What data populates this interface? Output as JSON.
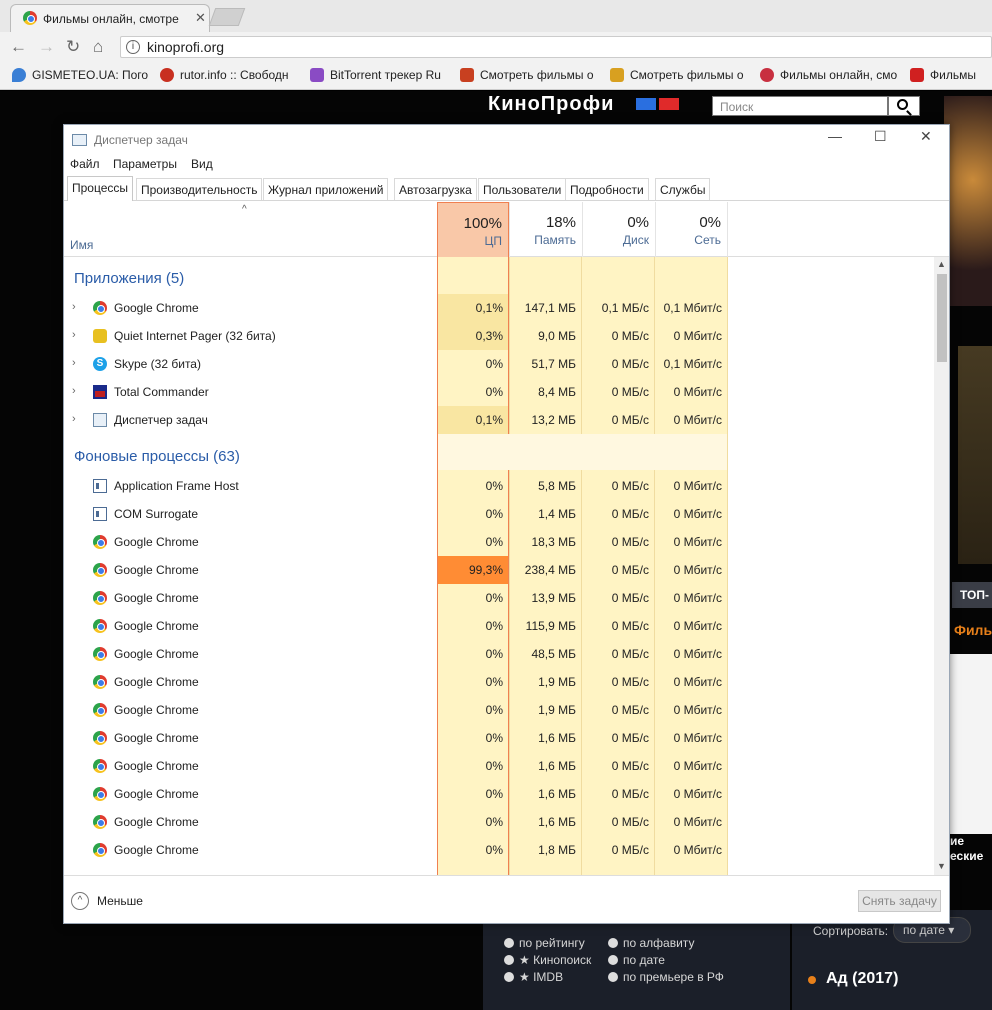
{
  "browser": {
    "tab_title": "Фильмы онлайн, смотре",
    "url": "kinoprofi.org",
    "bookmarks": [
      {
        "label": "GISMETEO.UA: Погод",
        "color": "#3a7fd5"
      },
      {
        "label": "rutor.info :: Свободн",
        "color": "#c83020"
      },
      {
        "label": "BitTorrent трекер Ru",
        "color": "#8a4bc4"
      },
      {
        "label": "Смотреть фильмы о",
        "color": "#c84020"
      },
      {
        "label": "Смотреть фильмы о",
        "color": "#d8a020"
      },
      {
        "label": "Фильмы онлайн, смо",
        "color": "#c83040"
      },
      {
        "label": "Фильмы",
        "color": "#d02020"
      }
    ]
  },
  "site": {
    "logo": "КиноПрофи",
    "search_placeholder": "Поиск",
    "top_button": "ТОП-",
    "films_label": "Филь",
    "side_text": [
      "ие",
      "еские"
    ],
    "sort": {
      "options_left": [
        "по рейтингу",
        "★ Кинопоиск",
        "★ IMDB"
      ],
      "options_right": [
        "по алфавиту",
        "по дате",
        "по премьере в РФ"
      ],
      "sort_label": "Сортировать:",
      "sort_value": "по дате"
    },
    "movie_title": "Ад (2017)"
  },
  "taskmanager": {
    "window_title": "Диспетчер задач",
    "menu": [
      "Файл",
      "Параметры",
      "Вид"
    ],
    "tabs": [
      "Процессы",
      "Производительность",
      "Журнал приложений",
      "Автозагрузка",
      "Пользователи",
      "Подробности",
      "Службы"
    ],
    "columns": {
      "name": "Имя",
      "cpu": {
        "pct": "100%",
        "label": "ЦП"
      },
      "mem": {
        "pct": "18%",
        "label": "Память"
      },
      "disk": {
        "pct": "0%",
        "label": "Диск"
      },
      "net": {
        "pct": "0%",
        "label": "Сеть"
      }
    },
    "group_apps": "Приложения (5)",
    "apps": [
      {
        "name": "Google Chrome",
        "icon": "chrome-icon",
        "cpu": "0,1%",
        "mem": "147,1 МБ",
        "disk": "0,1 МБ/с",
        "net": "0,1 Мбит/с"
      },
      {
        "name": "Quiet Internet Pager (32 бита)",
        "icon": "qip-icon",
        "cpu": "0,3%",
        "mem": "9,0 МБ",
        "disk": "0 МБ/с",
        "net": "0 Мбит/с"
      },
      {
        "name": "Skype (32 бита)",
        "icon": "skype-icon",
        "cpu": "0%",
        "mem": "51,7 МБ",
        "disk": "0 МБ/с",
        "net": "0,1 Мбит/с"
      },
      {
        "name": "Total Commander",
        "icon": "total-commander-icon",
        "cpu": "0%",
        "mem": "8,4 МБ",
        "disk": "0 МБ/с",
        "net": "0 Мбит/с"
      },
      {
        "name": "Диспетчер задач",
        "icon": "task-manager-icon",
        "cpu": "0,1%",
        "mem": "13,2 МБ",
        "disk": "0 МБ/с",
        "net": "0 Мбит/с"
      }
    ],
    "group_bg": "Фоновые процессы (63)",
    "bg": [
      {
        "name": "Application Frame Host",
        "icon": "app-frame-icon",
        "cpu": "0%",
        "mem": "5,8 МБ",
        "disk": "0 МБ/с",
        "net": "0 Мбит/с"
      },
      {
        "name": "COM Surrogate",
        "icon": "app-frame-icon",
        "cpu": "0%",
        "mem": "1,4 МБ",
        "disk": "0 МБ/с",
        "net": "0 Мбит/с"
      },
      {
        "name": "Google Chrome",
        "icon": "chrome-icon",
        "cpu": "0%",
        "mem": "18,3 МБ",
        "disk": "0 МБ/с",
        "net": "0 Мбит/с"
      },
      {
        "name": "Google Chrome",
        "icon": "chrome-icon",
        "cpu": "99,3%",
        "mem": "238,4 МБ",
        "disk": "0 МБ/с",
        "net": "0 Мбит/с"
      },
      {
        "name": "Google Chrome",
        "icon": "chrome-icon",
        "cpu": "0%",
        "mem": "13,9 МБ",
        "disk": "0 МБ/с",
        "net": "0 Мбит/с"
      },
      {
        "name": "Google Chrome",
        "icon": "chrome-icon",
        "cpu": "0%",
        "mem": "115,9 МБ",
        "disk": "0 МБ/с",
        "net": "0 Мбит/с"
      },
      {
        "name": "Google Chrome",
        "icon": "chrome-icon",
        "cpu": "0%",
        "mem": "48,5 МБ",
        "disk": "0 МБ/с",
        "net": "0 Мбит/с"
      },
      {
        "name": "Google Chrome",
        "icon": "chrome-icon",
        "cpu": "0%",
        "mem": "1,9 МБ",
        "disk": "0 МБ/с",
        "net": "0 Мбит/с"
      },
      {
        "name": "Google Chrome",
        "icon": "chrome-icon",
        "cpu": "0%",
        "mem": "1,9 МБ",
        "disk": "0 МБ/с",
        "net": "0 Мбит/с"
      },
      {
        "name": "Google Chrome",
        "icon": "chrome-icon",
        "cpu": "0%",
        "mem": "1,6 МБ",
        "disk": "0 МБ/с",
        "net": "0 Мбит/с"
      },
      {
        "name": "Google Chrome",
        "icon": "chrome-icon",
        "cpu": "0%",
        "mem": "1,6 МБ",
        "disk": "0 МБ/с",
        "net": "0 Мбит/с"
      },
      {
        "name": "Google Chrome",
        "icon": "chrome-icon",
        "cpu": "0%",
        "mem": "1,6 МБ",
        "disk": "0 МБ/с",
        "net": "0 Мбит/с"
      },
      {
        "name": "Google Chrome",
        "icon": "chrome-icon",
        "cpu": "0%",
        "mem": "1,6 МБ",
        "disk": "0 МБ/с",
        "net": "0 Мбит/с"
      },
      {
        "name": "Google Chrome",
        "icon": "chrome-icon",
        "cpu": "0%",
        "mem": "1,8 МБ",
        "disk": "0 МБ/с",
        "net": "0 Мбит/с"
      }
    ],
    "footer_less": "Меньше",
    "end_task": "Снять задачу"
  }
}
